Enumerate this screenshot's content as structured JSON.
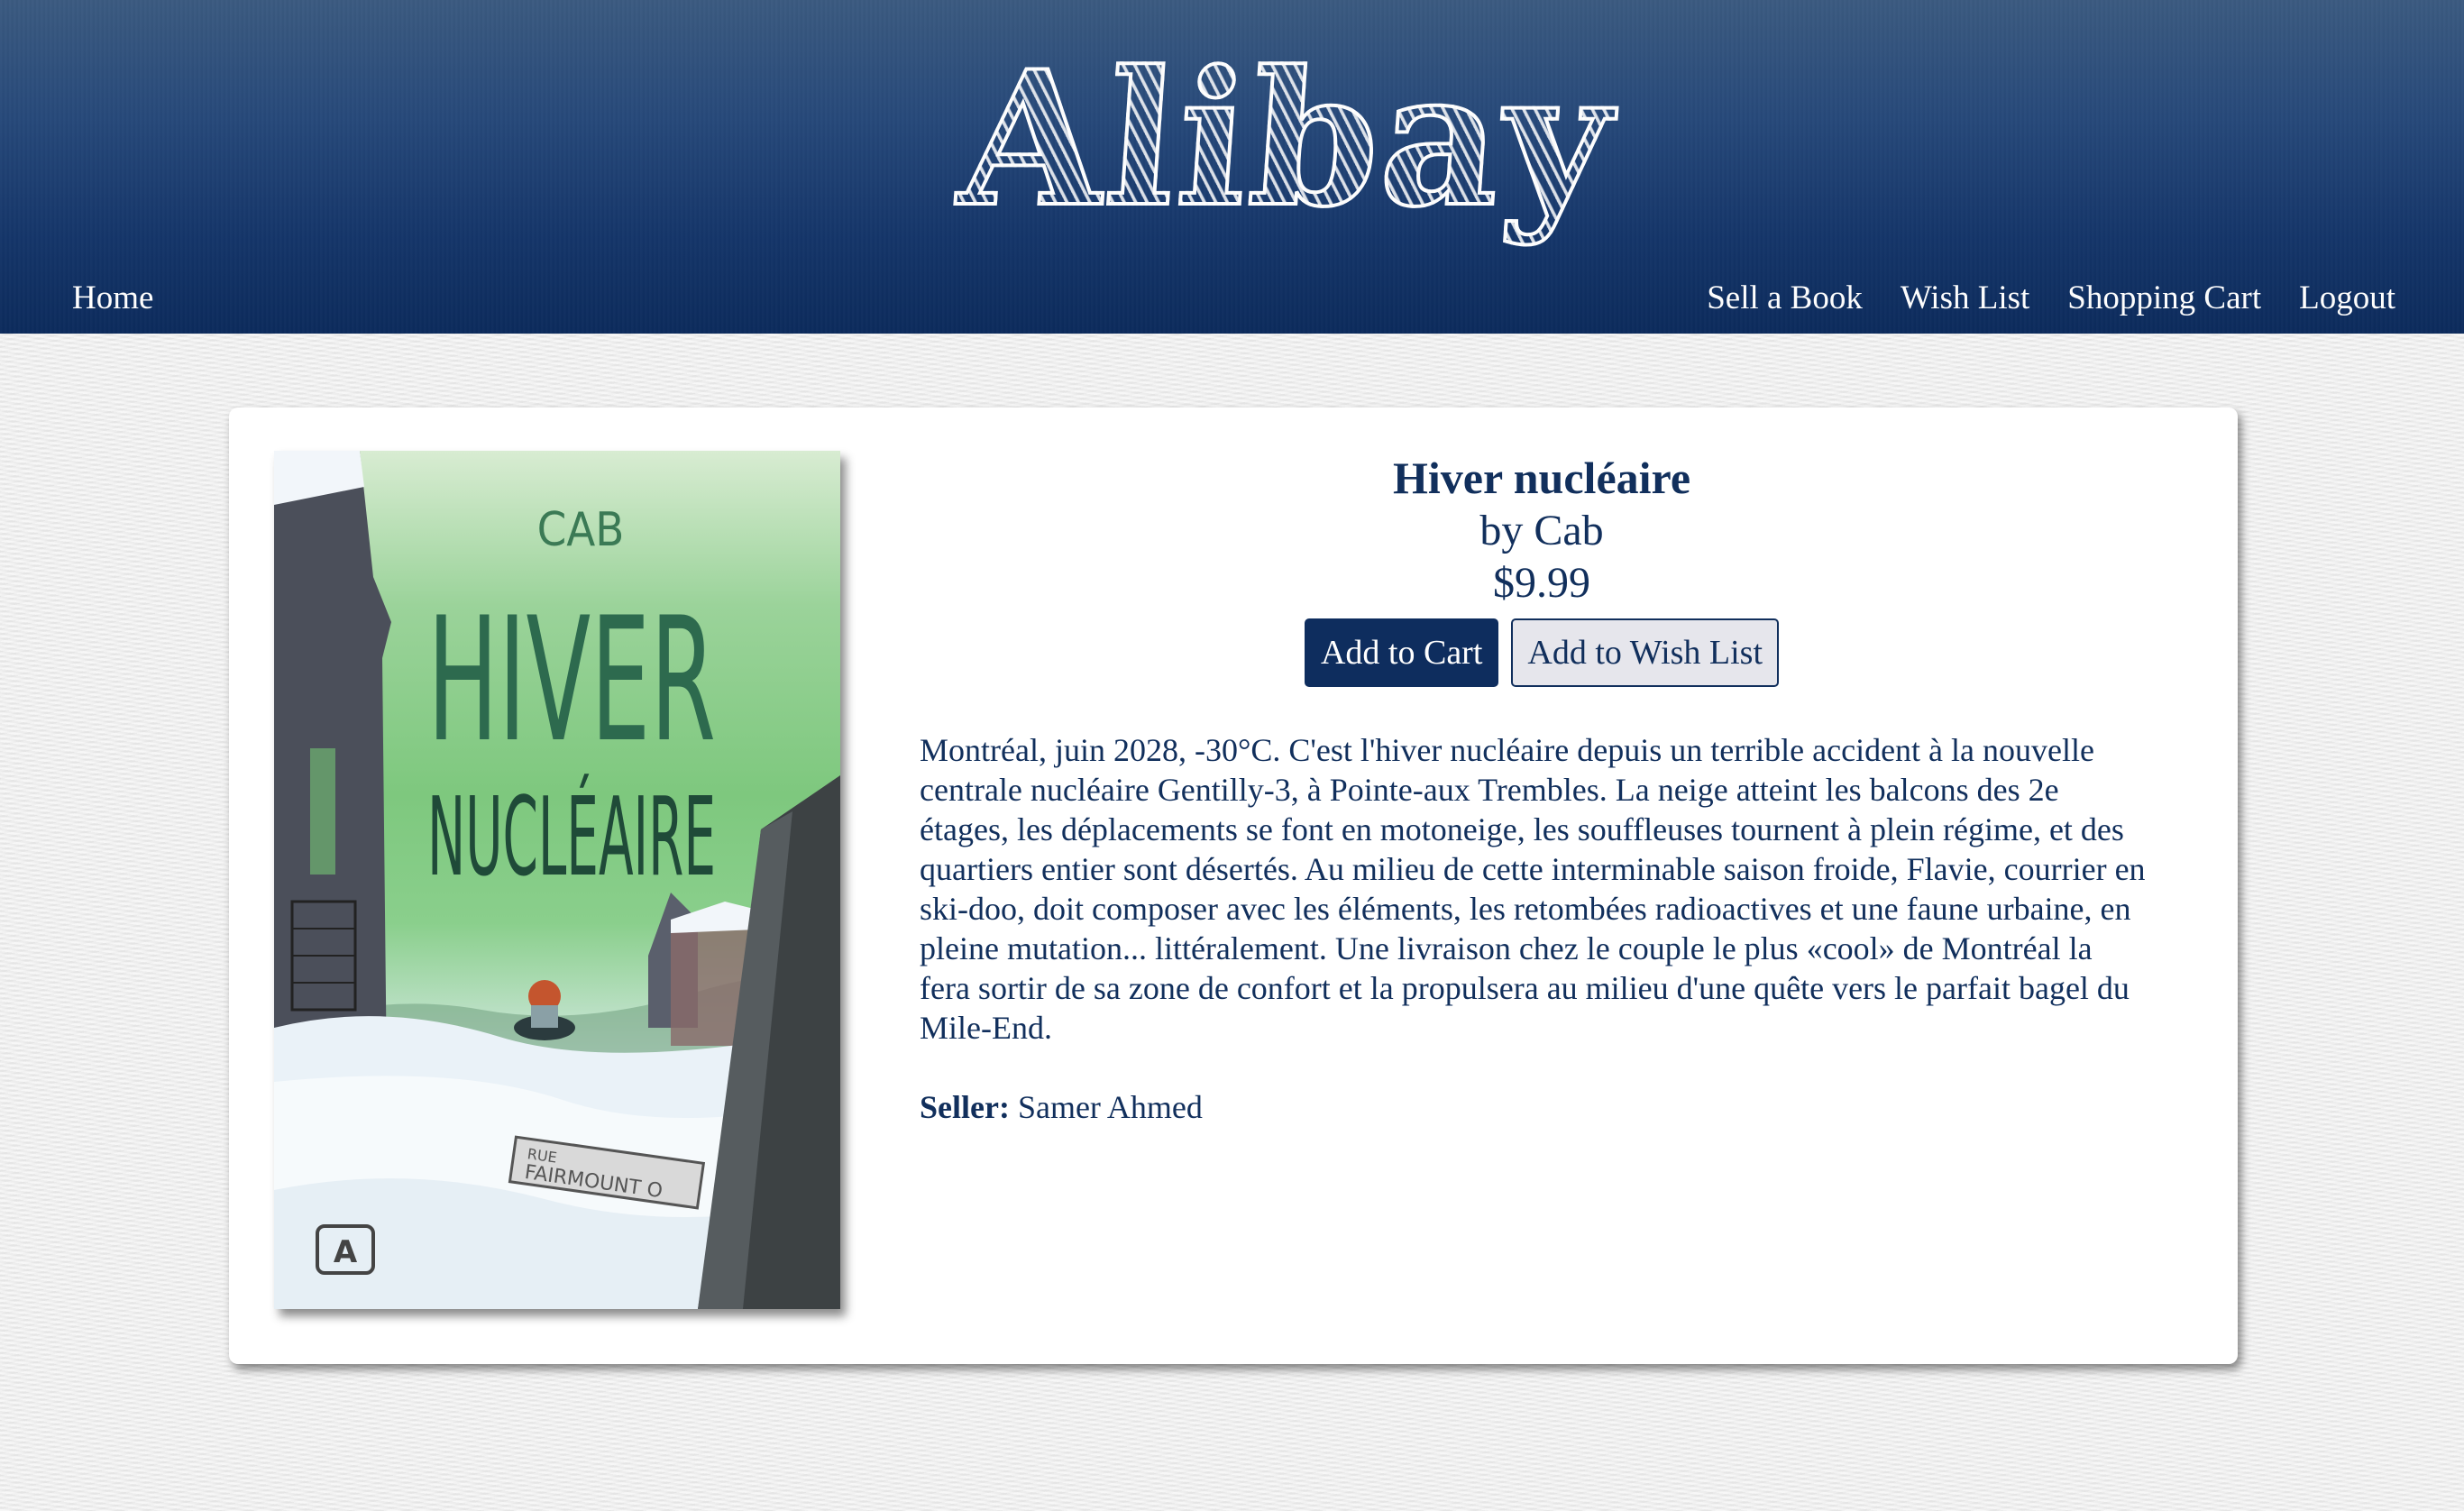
{
  "brand": {
    "logo_text": "Alibay"
  },
  "nav": {
    "home": "Home",
    "sell": "Sell a Book",
    "wishlist": "Wish List",
    "cart": "Shopping Cart",
    "logout": "Logout"
  },
  "book": {
    "title": "Hiver nucléaire",
    "author": "by Cab",
    "price": "$9.99",
    "description": "Montréal, juin 2028, -30°C. C'est l'hiver nucléaire depuis un terrible accident à la nouvelle centrale nucléaire Gentilly-3, à Pointe-aux Trembles. La neige atteint les balcons des 2e étages, les déplacements se font en motoneige, les souffleuses tournent à plein régime, et des quartiers entier sont désertés. Au milieu de cette interminable saison froide, Flavie, courrier en ski-doo, doit composer avec les éléments, les retombées radioactives et une faune urbaine, en pleine mutation... littéralement. Une livraison chez le couple le plus «cool» de Montréal la fera sortir de sa zone de confort et la propulsera au milieu d'une quête vers le parfait bagel du Mile-End.",
    "seller_label": "Seller:",
    "seller_name": "Samer Ahmed",
    "cover": {
      "author": "CAB",
      "title_line1": "HIVER",
      "title_line2": "NUCLÉAIRE",
      "street_sign_line1": "RUE",
      "street_sign_line2": "FAIRMOUNT O",
      "publisher_mark": "A"
    }
  },
  "actions": {
    "add_to_cart": "Add to Cart",
    "add_to_wishlist": "Add to Wish List"
  },
  "colors": {
    "header_dark": "#0c2b5c",
    "accent": "#0e2d5e",
    "text": "#112f5c"
  }
}
